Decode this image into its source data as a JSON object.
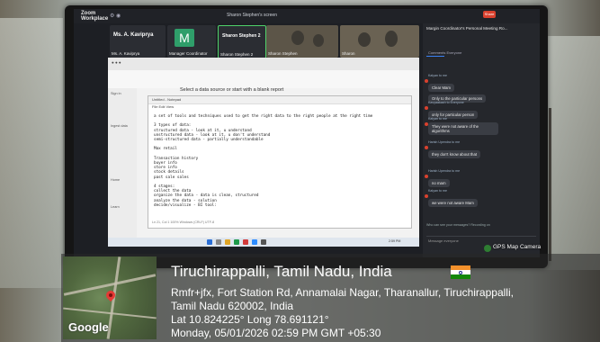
{
  "zoom": {
    "brand": "Zoom Workplace",
    "meeting_title": "Sharon Stephen's screen",
    "share_label": "Share",
    "participants": [
      {
        "name": "Ms. A. Kaviprya",
        "sub": "Ms. A. Kaviprya"
      },
      {
        "name": "Manager Coordinator",
        "avatar": "M"
      },
      {
        "name": "Sharon Stephen 2",
        "sub": "Sharon Stephen 2"
      },
      {
        "name": "Sharon Stephen"
      },
      {
        "name": "Sharon"
      }
    ]
  },
  "shared_screen": {
    "hint": "Select a data source or start with a blank report",
    "left_pane_items": [
      "Sign in",
      "Ingest data",
      "Home",
      "Learn"
    ],
    "notepad": {
      "tab": "Untitled - Notepad",
      "menu": "File   Edit   View",
      "lines": [
        "a set of tools and techniques used to get the right data to the right people at the right time",
        "",
        "3 types of data:",
        "structured data - look at it, u understand",
        "unstructured data - look at it, u don't understand",
        "semi-structured data - partially understandable",
        "",
        "Max retail",
        "",
        "Transaction history",
        "buyer info",
        "store info",
        "stock details",
        "past sale sales",
        "",
        "4 stages:",
        "collect the data",
        "organize the data - data is clean, structured",
        "analyze the data - solution",
        "decide/visualize - BI tool:"
      ],
      "status": "Ln 21, Col 1   100%   Windows (CRLF)   UTF-8"
    },
    "taskbar_time": "2:59 PM"
  },
  "chat": {
    "title": "Margin Coordinator's Personal Meeting Ro...",
    "tabs": "Comments   Everyone",
    "messages": [
      {
        "name": "Kalyan to me",
        "text": "Clear Mam"
      },
      {
        "name": "",
        "text": "Only to the particular persons"
      },
      {
        "name": "Kavyaakash to Everyone",
        "text": "only for particular person"
      },
      {
        "name": "Kalyan to me",
        "text": "They were not aware of the algorithms"
      },
      {
        "name": "Harish Upendra to me",
        "text": "they don't know about that"
      },
      {
        "name": "Harish Upendra to me",
        "text": "no mam"
      },
      {
        "name": "Kalyan to me",
        "text": "we were not aware Mam"
      }
    ],
    "who_can_see": "Who can see your messages? Recording on",
    "input_placeholder": "Message everyone"
  },
  "gps": {
    "app_label": "GPS Map Camera",
    "city": "Tiruchirappalli, Tamil Nadu, India",
    "address_line1": "Rmfr+jfx, Fort Station Rd, Annamalai Nagar, Tharanallur, Tiruchirappalli,",
    "address_line2": "Tamil Nadu 620002, India",
    "coords": "Lat 10.824225° Long 78.691121°",
    "datetime": "Monday, 05/01/2026 02:59 PM GMT +05:30",
    "map_logo": "Google"
  }
}
